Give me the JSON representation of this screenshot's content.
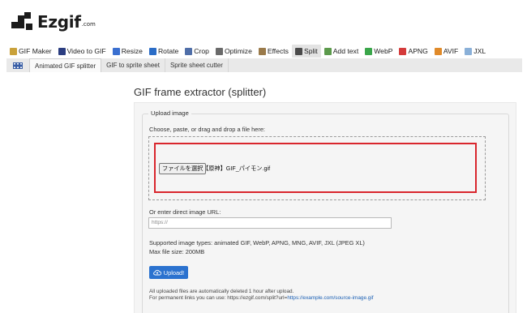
{
  "brand": {
    "name": "Ezgif",
    "suffix": ".com"
  },
  "nav": [
    {
      "label": "GIF Maker",
      "icon": "gif-maker-icon",
      "color": "#c9a13a"
    },
    {
      "label": "Video to GIF",
      "icon": "video-to-gif-icon",
      "color": "#2b3d80"
    },
    {
      "label": "Resize",
      "icon": "resize-icon",
      "color": "#3a6fd0"
    },
    {
      "label": "Rotate",
      "icon": "rotate-icon",
      "color": "#2a6cc6"
    },
    {
      "label": "Crop",
      "icon": "crop-icon",
      "color": "#4f6ea8"
    },
    {
      "label": "Optimize",
      "icon": "optimize-icon",
      "color": "#6a6a6a"
    },
    {
      "label": "Effects",
      "icon": "effects-icon",
      "color": "#9a7a4a"
    },
    {
      "label": "Split",
      "icon": "split-icon",
      "color": "#4a4a4a",
      "active": true
    },
    {
      "label": "Add text",
      "icon": "add-text-icon",
      "color": "#5c9a4c"
    },
    {
      "label": "WebP",
      "icon": "webp-icon",
      "color": "#3aa64a"
    },
    {
      "label": "APNG",
      "icon": "apng-icon",
      "color": "#d43a3a"
    },
    {
      "label": "AVIF",
      "icon": "avif-icon",
      "color": "#e08a2a"
    },
    {
      "label": "JXL",
      "icon": "jxl-icon",
      "color": "#8ab0d8"
    }
  ],
  "subnav": [
    {
      "label": "Animated GIF splitter",
      "active": true
    },
    {
      "label": "GIF to sprite sheet"
    },
    {
      "label": "Sprite sheet cutter"
    }
  ],
  "page": {
    "title": "GIF frame extractor (splitter)"
  },
  "upload": {
    "legend": "Upload image",
    "drop_label": "Choose, paste, or drag and drop a file here:",
    "file_button": "ファイルを選択",
    "file_name": "【原神】GIF_パイモン.gif",
    "url_label": "Or enter direct image URL:",
    "url_placeholder": "https://",
    "supported": "Supported image types: animated GIF, WebP, APNG, MNG, AVIF, JXL (JPEG XL)",
    "max_size": "Max file size: 200MB",
    "button": "Upload!",
    "note1": "All uploaded files are automatically deleted 1 hour after upload.",
    "note2_prefix": "For permanent links you can use: https://ezgif.com/split?url=",
    "note2_link": "https://example.com/source-image.gif"
  },
  "colors": {
    "accent": "#2b72cf",
    "highlight": "#d9262d"
  }
}
